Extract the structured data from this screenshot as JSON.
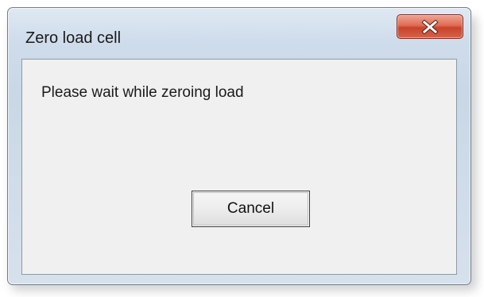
{
  "window": {
    "title": "Zero load cell",
    "close_icon": "close-icon"
  },
  "dialog": {
    "message": "Please wait while zeroing load",
    "cancel_label": "Cancel"
  },
  "colors": {
    "close_button": "#d6634b",
    "client_background": "#f0f0f0",
    "title_gradient_top": "#dfe9f3"
  }
}
